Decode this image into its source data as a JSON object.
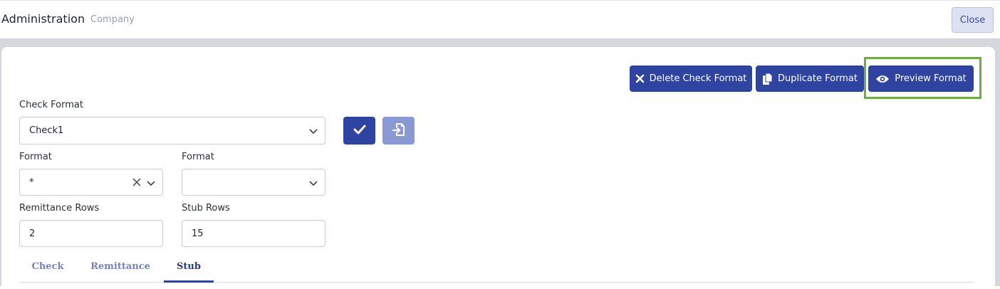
{
  "header": {
    "title": "Administration",
    "breadcrumb": "Company",
    "close_label": "Close"
  },
  "toolbar": {
    "delete_label": "Delete Check Format",
    "duplicate_label": "Duplicate Format",
    "preview_label": "Preview Format",
    "delete_icon": "x-icon",
    "duplicate_icon": "copy-icon",
    "preview_icon": "eye-icon",
    "highlight_color": "#6fac46"
  },
  "form": {
    "check_format_label": "Check Format",
    "check_format_value": "Check1",
    "format1_label": "Format",
    "format1_value": "*",
    "format2_label": "Format",
    "format2_value": "",
    "remittance_rows_label": "Remittance Rows",
    "remittance_rows_value": "2",
    "stub_rows_label": "Stub Rows",
    "stub_rows_value": "15"
  },
  "actions": {
    "confirm_icon": "check-icon",
    "import_icon": "import-file-icon"
  },
  "tabs": [
    {
      "label": "Check",
      "active": false
    },
    {
      "label": "Remittance",
      "active": false
    },
    {
      "label": "Stub",
      "active": true
    }
  ],
  "colors": {
    "primary": "#2e44a0",
    "primary_disabled": "#8a98d3"
  }
}
